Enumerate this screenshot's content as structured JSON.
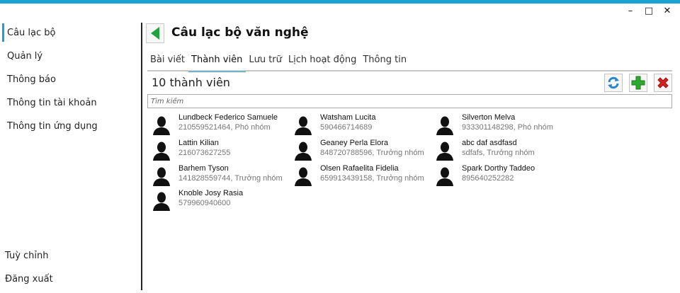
{
  "window": {
    "minimize": "–",
    "maximize": "□",
    "close": "✕"
  },
  "sidebar": {
    "items": [
      {
        "label": "Câu lạc bộ",
        "active": true
      },
      {
        "label": "Quản lý"
      },
      {
        "label": "Thông báo"
      },
      {
        "label": "Thông tin tài khoản"
      },
      {
        "label": "Thông tin ứng dụng"
      }
    ],
    "bottom_items": [
      {
        "label": "Tuỳ chỉnh"
      },
      {
        "label": "Đăng xuất"
      }
    ]
  },
  "header": {
    "title": "Câu lạc bộ văn nghệ"
  },
  "tabs": [
    {
      "label": "Bài viết"
    },
    {
      "label": "Thành viên",
      "active": true
    },
    {
      "label": "Lưu trữ"
    },
    {
      "label": "Lịch hoạt động"
    },
    {
      "label": "Thông tin"
    }
  ],
  "members_panel": {
    "count_label": "10 thành viên",
    "search_placeholder": "Tìm kiếm",
    "icons": {
      "refresh": "refresh-icon",
      "add": "add-icon",
      "delete": "delete-icon"
    },
    "colors": {
      "accent": "#1ba1d1",
      "add": "#2fa82f",
      "delete": "#d52020",
      "back": "#1fa33a"
    }
  },
  "members": [
    {
      "name": "Lundbeck Federico Samuele",
      "sub": "210559521464, Phó nhóm"
    },
    {
      "name": "Watsham Lucita",
      "sub": "590466714689"
    },
    {
      "name": "Silverton Melva",
      "sub": "933301148298, Phó nhóm"
    },
    {
      "name": "Lattin Kilian",
      "sub": "216073627255"
    },
    {
      "name": "Geaney Perla Elora",
      "sub": "848720788596, Trưởng nhóm"
    },
    {
      "name": "abc daf asdfasd",
      "sub": "sdfafs, Trưởng nhóm"
    },
    {
      "name": "Barhem Tyson",
      "sub": "141828559744, Trưởng nhóm"
    },
    {
      "name": "Olsen Rafaelita Fidelia",
      "sub": "659913439158, Trưởng nhóm"
    },
    {
      "name": "Spark Dorthy Taddeo",
      "sub": "895640252282"
    },
    {
      "name": "Knoble Josy Rasia",
      "sub": "579960940600"
    }
  ]
}
